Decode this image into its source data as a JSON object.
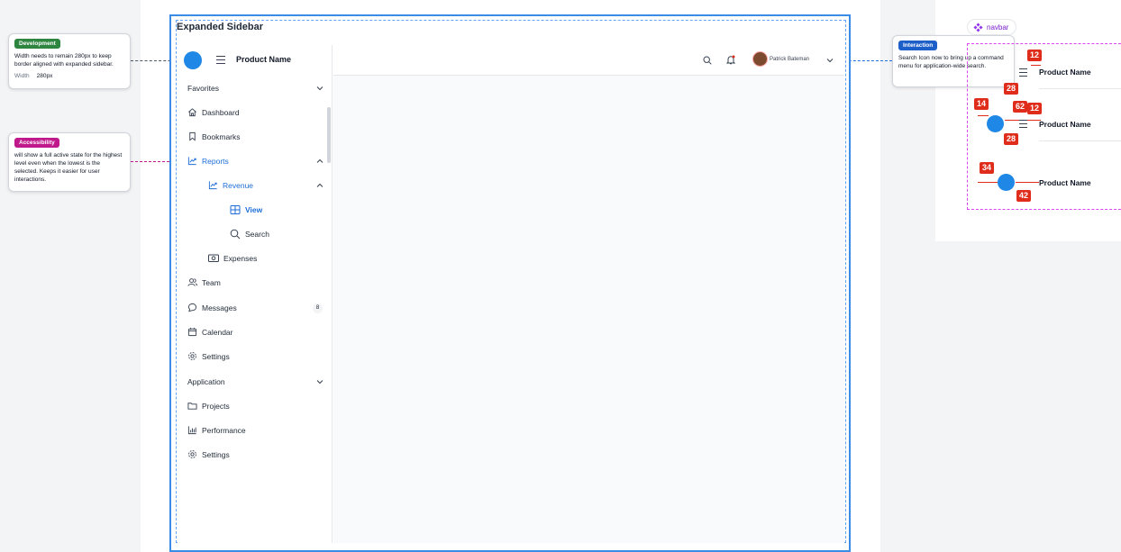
{
  "frame": {
    "title": "Expanded Sidebar"
  },
  "annotations": {
    "development": {
      "tag": "Development",
      "tag_color": "#2e8540",
      "text": "Width needs to remain 280px to keep border aligned with expanded sidebar.",
      "meta_label": "Width",
      "meta_value": "280px"
    },
    "accessibility": {
      "tag": "Accessibility",
      "tag_color": "#c0198c",
      "text": "will show a full active state for the highest level even when the lowest is the selected. Keeps it easier for user interactions."
    },
    "interaction": {
      "tag": "Interaction",
      "tag_color": "#1d5fc9",
      "text": "Search Icon now to bring up a command menu for application-wide search."
    }
  },
  "sidebar": {
    "product_name": "Product Name",
    "favorites_label": "Favorites",
    "items": [
      {
        "label": "Dashboard",
        "icon": "home-icon"
      },
      {
        "label": "Bookmarks",
        "icon": "bookmark-icon"
      },
      {
        "label": "Reports",
        "icon": "chart-line-icon"
      },
      {
        "label": "Revenue",
        "icon": "chart-line-icon"
      },
      {
        "label": "View",
        "icon": "grid-icon"
      },
      {
        "label": "Search",
        "icon": "search-icon"
      },
      {
        "label": "Expenses",
        "icon": "money-icon"
      },
      {
        "label": "Team",
        "icon": "users-icon"
      },
      {
        "label": "Messages",
        "icon": "chat-icon",
        "badge": "8"
      },
      {
        "label": "Calendar",
        "icon": "calendar-icon"
      },
      {
        "label": "Settings",
        "icon": "gear-icon"
      }
    ],
    "application_label": "Application",
    "app_items": [
      {
        "label": "Projects",
        "icon": "folder-icon"
      },
      {
        "label": "Performance",
        "icon": "bar-chart-icon"
      },
      {
        "label": "Settings",
        "icon": "gear-icon"
      }
    ]
  },
  "topbar": {
    "user_name": "Patrick Bateman"
  },
  "spec": {
    "pill_label": "navbar",
    "product_name": "Product Name",
    "measurements": [
      "12",
      "28",
      "14",
      "62",
      "12",
      "28",
      "34",
      "42"
    ]
  },
  "colors": {
    "accent": "#1d6ed8",
    "brand_circle": "#1f87e5",
    "frame_border": "#3b8ce6",
    "redline": "#e02d1b"
  }
}
